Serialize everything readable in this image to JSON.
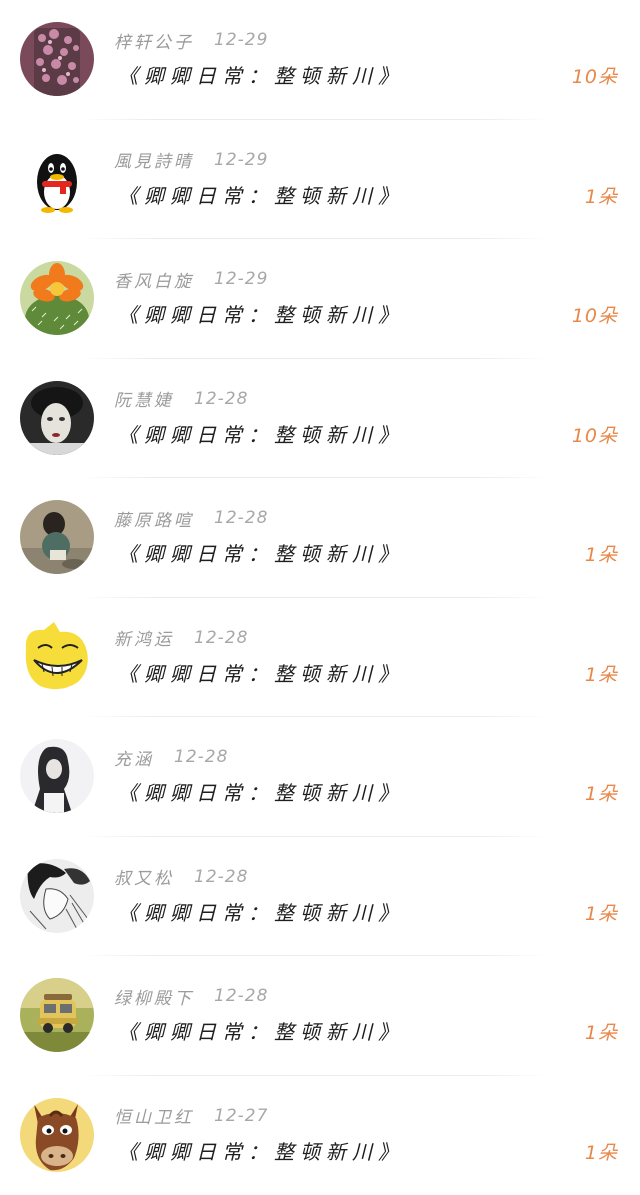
{
  "entries": [
    {
      "user": "梓轩公子",
      "date": "12-29",
      "title": "《卿卿日常：整顿新川》",
      "gift": "10朵",
      "avatar": "purple-flowers-avatar"
    },
    {
      "user": "風見詩晴",
      "date": "12-29",
      "title": "《卿卿日常：整顿新川》",
      "gift": "1朵",
      "avatar": "penguin-avatar"
    },
    {
      "user": "香风白旋",
      "date": "12-29",
      "title": "《卿卿日常：整顿新川》",
      "gift": "10朵",
      "avatar": "cactus-flower-avatar"
    },
    {
      "user": "阮慧婕",
      "date": "12-28",
      "title": "《卿卿日常：整顿新川》",
      "gift": "10朵",
      "avatar": "mime-face-avatar"
    },
    {
      "user": "藤原路喧",
      "date": "12-28",
      "title": "《卿卿日常：整顿新川》",
      "gift": "1朵",
      "avatar": "child-reading-avatar"
    },
    {
      "user": "新鸿运",
      "date": "12-28",
      "title": "《卿卿日常：整顿新川》",
      "gift": "1朵",
      "avatar": "trollface-avatar"
    },
    {
      "user": "充涵",
      "date": "12-28",
      "title": "《卿卿日常：整顿新川》",
      "gift": "1朵",
      "avatar": "girl-silhouette-avatar"
    },
    {
      "user": "叔又松",
      "date": "12-28",
      "title": "《卿卿日常：整顿新川》",
      "gift": "1朵",
      "avatar": "manga-sketch-avatar"
    },
    {
      "user": "绿柳殿下",
      "date": "12-28",
      "title": "《卿卿日常：整顿新川》",
      "gift": "1朵",
      "avatar": "toy-van-avatar"
    },
    {
      "user": "恒山卫红",
      "date": "12-27",
      "title": "《卿卿日常：整顿新川》",
      "gift": "1朵",
      "avatar": "cartoon-horse-avatar"
    }
  ],
  "colors": {
    "gift": "#e8884a",
    "username": "#9b9b9b",
    "title": "#1e1e1e"
  }
}
